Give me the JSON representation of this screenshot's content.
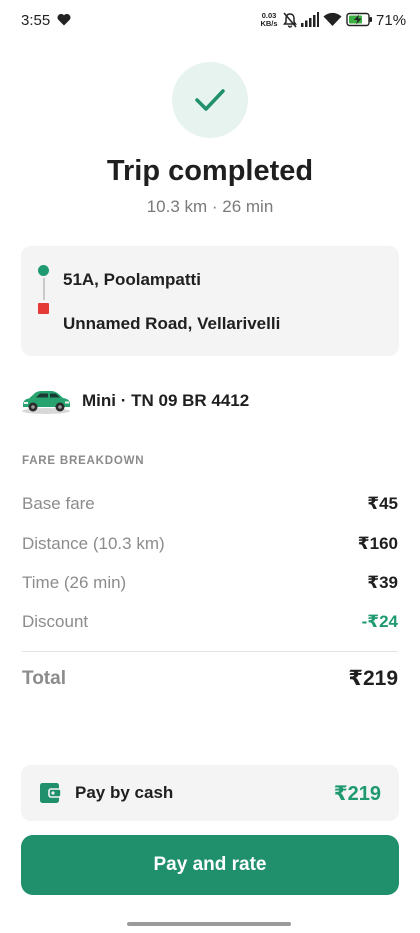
{
  "status_bar": {
    "time": "3:55",
    "net_speed_value": "0.03",
    "net_speed_unit": "KB/s",
    "battery_percent": "71",
    "battery_percent_suffix": "%",
    "icons": [
      "heart-icon",
      "silent-bell-icon",
      "signal-icon",
      "wifi-icon",
      "battery-charging-icon"
    ]
  },
  "header": {
    "title": "Trip completed",
    "subtitle": "10.3 km · 26 min",
    "icon": "check-icon"
  },
  "route": {
    "pickup": "51A, Poolampatti",
    "dropoff": "Unnamed Road, Vellarivelli"
  },
  "vehicle": {
    "label": "Mini · TN 09 BR 4412",
    "icon": "car-icon"
  },
  "fare": {
    "heading": "FARE BREAKDOWN",
    "rows": [
      {
        "label": "Base fare",
        "amount": "₹45"
      },
      {
        "label": "Distance (10.3 km)",
        "amount": "₹160"
      },
      {
        "label": "Time (26 min)",
        "amount": "₹39"
      },
      {
        "label": "Discount",
        "amount": "-₹24"
      }
    ],
    "total_label": "Total",
    "total_amount": "₹219"
  },
  "payment": {
    "method": "Pay by cash",
    "amount": "₹219",
    "icon": "wallet-icon"
  },
  "action": {
    "button_label": "Pay and rate"
  },
  "colors": {
    "accent": "#1f8f6c",
    "accent_light": "#e6f3ee",
    "discount": "#1f9a70",
    "destination": "#e53935"
  }
}
